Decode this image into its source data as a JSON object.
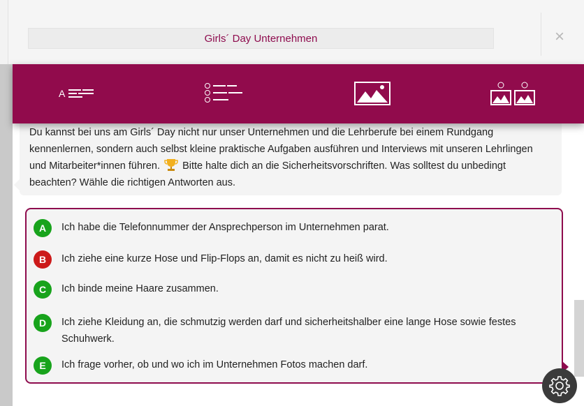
{
  "header": {
    "title": "Girls´ Day Unternehmen",
    "close_label": "×"
  },
  "toolbar": {
    "tools": [
      {
        "icon": "text-lines-icon"
      },
      {
        "icon": "multiple-choice-list-icon"
      },
      {
        "icon": "image-icon"
      },
      {
        "icon": "image-compare-icon"
      }
    ],
    "accent": "#910b4c"
  },
  "question": {
    "text_before": "Du kannst bei uns am Girls´ Day nicht nur unser Unternehmen und die Lehrberufe bei einem Rundgang kennenlernen, sondern auch selbst kleine praktische Aufgaben ausführen und Interviews mit unseren Lehrlingen und Mitarbeiter*innen führen.",
    "text_after": "Bitte halte dich an die Sicherheitsvorschriften. Was solltest du unbedingt beachten? Wähle die richtigen Antworten aus.",
    "emoji_icon": "trophy-icon"
  },
  "answers": [
    {
      "letter": "A",
      "text": "Ich habe die Telefonnummer der Ansprechperson im Unternehmen parat.",
      "status": "correct",
      "color": "#18a31c"
    },
    {
      "letter": "B",
      "text": "Ich ziehe eine kurze Hose und Flip-Flops an, damit es nicht zu heiß wird.",
      "status": "wrong",
      "color": "#cc1a1a"
    },
    {
      "letter": "C",
      "text": "Ich binde meine Haare zusammen.",
      "status": "correct",
      "color": "#18a31c"
    },
    {
      "letter": "D",
      "text": "Ich ziehe Kleidung an, die schmutzig werden darf und sicherheitshalber eine lange Hose sowie festes Schuhwerk.",
      "status": "correct",
      "color": "#18a31c"
    },
    {
      "letter": "E",
      "text": "Ich frage vorher, ob und wo ich im Unternehmen Fotos machen darf.",
      "status": "correct",
      "color": "#18a31c"
    }
  ],
  "settings": {
    "icon": "gear-icon"
  }
}
